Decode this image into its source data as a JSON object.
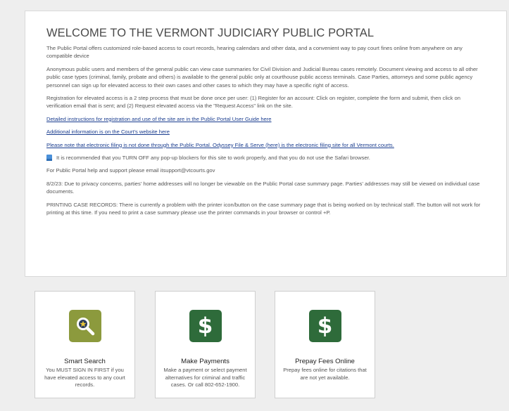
{
  "welcome": {
    "title": "WELCOME TO THE VERMONT JUDICIARY PUBLIC PORTAL",
    "paragraphs": [
      "The Public Portal offers customized role-based access to court records, hearing calendars and other data, and a convenient way to pay court fines online from anywhere on any compatible device",
      "Anonymous public users and members of the general public can view case summaries for Civil Division and Judicial Bureau cases remotely. Document viewing and access to all other public case types (criminal, family, probate and others) is available to the general public only at courthouse public access terminals. Case Parties, attorneys and some public agency personnel can sign up for elevated access to their own cases and other cases to which they may have a specific right of access.",
      "Registration for elevated access is a 2 step process that must be done once per user: (1) Register for an account: Click on register, complete the form and submit, then click on verification email that is sent; and (2) Request elevated access via the \"Request Access\" link on the site."
    ],
    "links": {
      "user_guide": "Detailed instructions for registration and use of the site are in the Public Portal User Guide here",
      "court_website": "Additional information is on the Court's website here",
      "efiling": "Please note that electronic filing is not done through the Public Portal. Odyssey File & Serve (here) is the electronic filing site for all Vermont courts."
    },
    "popup_note": "It is recommended that you TURN OFF any pop-up blockers for this site to work properly, and that you do not use the Safari browser.",
    "support": "For Public Portal help and support please email itsupport@vtcourts.gov",
    "privacy": "8/2/23: Due to privacy concerns, parties' home addresses will no longer be viewable on the Public Portal case summary page. Parties' addresses may still be viewed on individual case documents.",
    "printing": "PRINTING CASE RECORDS: There is currently a problem with the printer icon/button on the case summary page that is being worked on by technical staff. The button will not work for printing at this time. If you need to print a case summary please use the printer commands in your browser or control +P."
  },
  "tiles": [
    {
      "title": "Smart Search",
      "description": "You MUST SIGN IN FIRST if you have elevated access to any court records.",
      "icon": "magnifier-icon",
      "color": "#8c9a3d"
    },
    {
      "title": "Make Payments",
      "description": "Make a payment or select payment alternatives for criminal and traffic cases. Or call 802-652-1900.",
      "icon": "dollar-icon",
      "icon_glyph": "$",
      "color": "#2e6b3a"
    },
    {
      "title": "Prepay Fees Online",
      "description": "Prepay fees online for citations that are not yet available.",
      "icon": "dollar-icon",
      "icon_glyph": "$",
      "color": "#2e6b3a"
    }
  ]
}
